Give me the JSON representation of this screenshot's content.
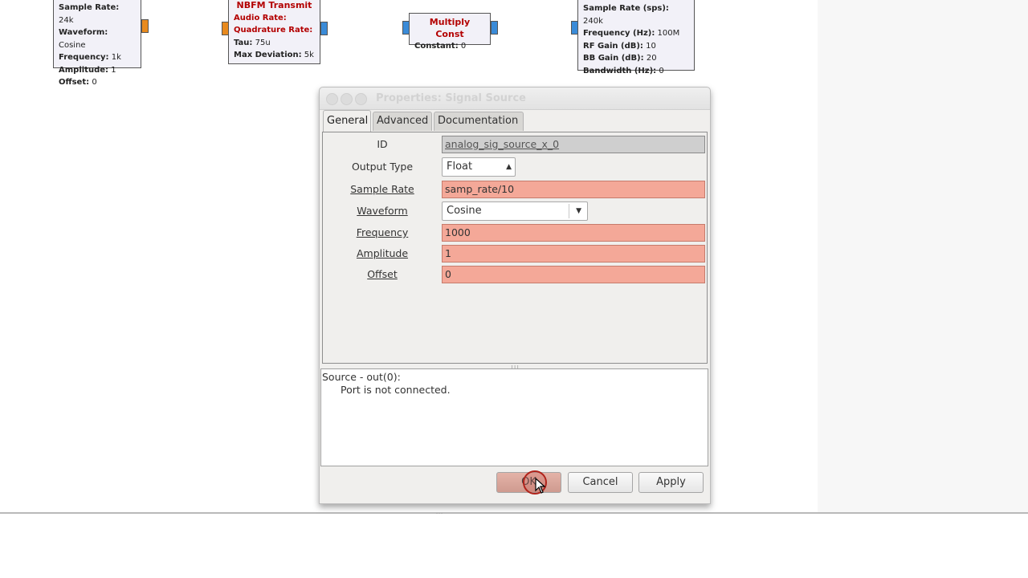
{
  "canvas": {
    "blocks": {
      "signal_source": {
        "params": [
          {
            "k": "Sample Rate:",
            "v": "24k"
          },
          {
            "k": "Waveform:",
            "v": "Cosine"
          },
          {
            "k": "Frequency:",
            "v": "1k"
          },
          {
            "k": "Amplitude:",
            "v": "1"
          },
          {
            "k": "Offset:",
            "v": "0"
          }
        ]
      },
      "nbfm": {
        "title": "NBFM Transmit",
        "params": [
          {
            "k": "Audio Rate:",
            "v": ""
          },
          {
            "k": "Quadrature Rate:",
            "v": ""
          },
          {
            "k": "Tau:",
            "v": "75u"
          },
          {
            "k": "Max Deviation:",
            "v": "5k"
          }
        ]
      },
      "multiply_const": {
        "title": "Multiply Const",
        "params": [
          {
            "k": "Constant:",
            "v": "0"
          }
        ]
      },
      "sink": {
        "params": [
          {
            "k": "Sample Rate (sps):",
            "v": "240k"
          },
          {
            "k": "Frequency (Hz):",
            "v": "100M"
          },
          {
            "k": "RF Gain (dB):",
            "v": "10"
          },
          {
            "k": "BB Gain (dB):",
            "v": "20"
          },
          {
            "k": "Bandwidth (Hz):",
            "v": "0"
          }
        ]
      }
    }
  },
  "dialog": {
    "title": "Properties: Signal Source",
    "tabs": [
      "General",
      "Advanced",
      "Documentation"
    ],
    "active_tab": "General",
    "params": {
      "id": {
        "label": "ID",
        "value": "analog_sig_source_x_0"
      },
      "output_type": {
        "label": "Output Type",
        "value": "Float"
      },
      "sample_rate": {
        "label": "Sample Rate",
        "value": "samp_rate/10"
      },
      "waveform": {
        "label": "Waveform",
        "value": "Cosine"
      },
      "frequency": {
        "label": "Frequency",
        "value": "1000"
      },
      "amplitude": {
        "label": "Amplitude",
        "value": "1"
      },
      "offset": {
        "label": "Offset",
        "value": "0"
      }
    },
    "console": {
      "line1": "Source - out(0):",
      "line2": "Port is not connected."
    },
    "buttons": {
      "ok": "OK",
      "cancel": "Cancel",
      "apply": "Apply"
    }
  },
  "colors": {
    "error_field": "#f4a898",
    "readonly_field": "#cfcfcf",
    "float_port": "#e88a1e",
    "complex_port": "#3a8bd8",
    "block_title": "#b30000"
  }
}
